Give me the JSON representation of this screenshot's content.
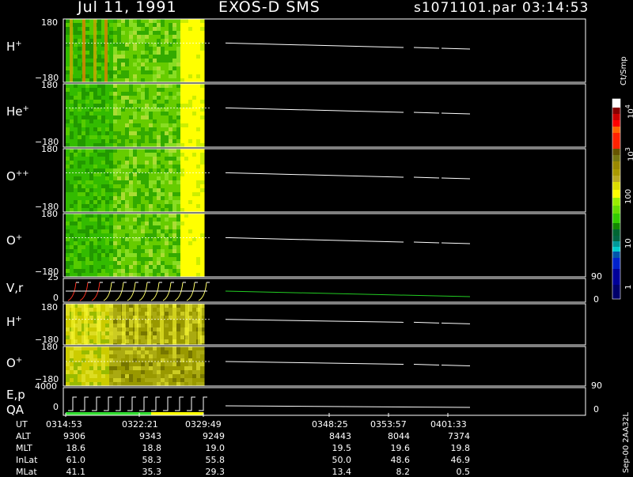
{
  "header": {
    "date": "Jul 11, 1991",
    "instrument": "EXOS-D SMS",
    "file": "s1071101.par",
    "time": "03:14:53"
  },
  "panels": {
    "h1": {
      "label": "H",
      "sup": "+",
      "top": "180",
      "bottom": "−180"
    },
    "he": {
      "label": "He",
      "sup": "+",
      "top": "180",
      "bottom": "−180"
    },
    "opp": {
      "label": "O",
      "sup": "++",
      "top": "180",
      "bottom": "−180"
    },
    "o1": {
      "label": "O",
      "sup": "+",
      "top": "180",
      "bottom": "−180"
    },
    "vr": {
      "label": "V,r",
      "top": "25",
      "bottom": "0",
      "right_top": "90",
      "right_bottom": "0"
    },
    "h2": {
      "label": "H",
      "sup": "+",
      "top": "180",
      "bottom": "−180"
    },
    "o2": {
      "label": "O",
      "sup": "+",
      "top": "180",
      "bottom": "−180"
    },
    "ep": {
      "label": "E,p",
      "top": "4000",
      "bottom": "0",
      "right_top": "90",
      "right_bottom": "0"
    },
    "qa": {
      "label": "QA"
    }
  },
  "colorbar": {
    "unit": "Ct/Smp",
    "labels": [
      "10",
      "4",
      "10",
      "3",
      "100",
      "10",
      "1"
    ]
  },
  "footer": {
    "stamp": "Sep-00  2AA32L",
    "rows": [
      {
        "name": "UT",
        "values": [
          "0314:53",
          "0322:21",
          "0329:49",
          "0348:25",
          "0353:57",
          "0401:33"
        ]
      },
      {
        "name": "ALT",
        "values": [
          "9306",
          "9343",
          "9249",
          "8443",
          "8044",
          "7374"
        ]
      },
      {
        "name": "MLT",
        "values": [
          "18.6",
          "18.8",
          "19.0",
          "19.5",
          "19.6",
          "19.8"
        ]
      },
      {
        "name": "InLat",
        "values": [
          "61.0",
          "58.3",
          "55.8",
          "50.0",
          "48.6",
          "46.9"
        ]
      },
      {
        "name": "MLat",
        "values": [
          "41.1",
          "35.3",
          "29.3",
          "13.4",
          "8.2",
          "0.5"
        ]
      }
    ]
  },
  "chart_data": {
    "type": "heatmap",
    "title": "Jul 11, 1991   EXOS-D SMS",
    "x_ticks_ut": [
      "0314:53",
      "0322:21",
      "0329:49",
      "0348:25",
      "0353:57",
      "0401:33"
    ],
    "colorbar": {
      "label": "Ct/Smp",
      "scale": "log",
      "range": [
        1,
        10000
      ],
      "ticks": [
        "1",
        "10",
        "100",
        "10^3",
        "10^4"
      ]
    },
    "panels": [
      {
        "name": "H+",
        "y_range": [
          -180,
          180
        ],
        "data_coverage": "0314:53-0329:49"
      },
      {
        "name": "He+",
        "y_range": [
          -180,
          180
        ],
        "data_coverage": "0314:53-0329:49"
      },
      {
        "name": "O++",
        "y_range": [
          -180,
          180
        ],
        "data_coverage": "0314:53-0329:49"
      },
      {
        "name": "O+",
        "y_range": [
          -180,
          180
        ],
        "data_coverage": "0314:53-0329:49"
      },
      {
        "name": "V,r",
        "y_range": [
          0,
          25
        ],
        "y2_range": [
          0,
          90
        ]
      },
      {
        "name": "H+",
        "y_range": [
          -180,
          180
        ],
        "data_coverage": "0314:53-0329:49"
      },
      {
        "name": "O+",
        "y_range": [
          -180,
          180
        ],
        "data_coverage": "0314:53-0329:49"
      },
      {
        "name": "E,p",
        "y_range": [
          0,
          4000
        ],
        "y2_range": [
          0,
          90
        ]
      }
    ]
  },
  "colors": {
    "background": "#000000",
    "foreground": "#ffffff",
    "high_green": "#33cc00",
    "low_yellow": "#ffff00",
    "olive": "#999900"
  }
}
